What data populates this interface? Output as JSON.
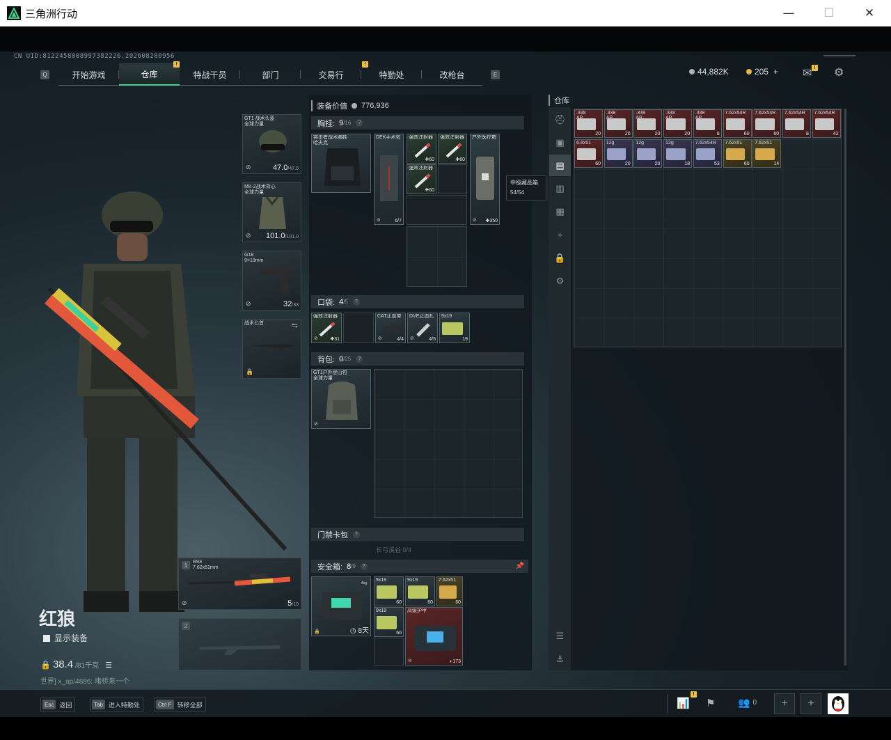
{
  "window": {
    "title": "三角洲行动",
    "minimize": "—",
    "maximize": "☐",
    "close": "✕"
  },
  "uid": "CN UID:8122458008997382226.202608280956",
  "nav": {
    "left_key": "Q",
    "right_key": "E",
    "tabs": [
      {
        "label": "开始游戏",
        "active": false,
        "badge": false
      },
      {
        "label": "仓库",
        "active": true,
        "badge": false
      },
      {
        "label": "特战干员",
        "active": false,
        "badge": true
      },
      {
        "label": "部门",
        "active": false,
        "badge": false
      },
      {
        "label": "交易行",
        "active": false,
        "badge": false
      },
      {
        "label": "特勤处",
        "active": false,
        "badge": true
      },
      {
        "label": "改枪台",
        "active": false,
        "badge": false
      }
    ]
  },
  "currency": {
    "silver": "44,882K",
    "gold": "205",
    "gold_add": "+",
    "silver_color": "#a9b4b8",
    "gold_color": "#e0b64a"
  },
  "mail_badge": "!",
  "character": {
    "name": "红狼",
    "show_gear_label": "显示装备",
    "weight": "38.4",
    "weight_max": "/81千克",
    "chat": "世界] x_ap/4886: 堵桥来一个"
  },
  "gear_slots": [
    {
      "label": "GT1 战术头盔",
      "sub": "全球力量",
      "value": "47.0",
      "max": "/47.0"
    },
    {
      "label": "MK-2战术背心",
      "sub": "全球力量",
      "value": "101.0",
      "max": "/101.0"
    },
    {
      "label": "G18",
      "sub": "9×19mm",
      "value": "32",
      "max": "/33"
    },
    {
      "label": "战术匕首",
      "sub": "",
      "value": "",
      "max": ""
    }
  ],
  "weapons": [
    {
      "slot": "1",
      "name": "R93",
      "caliber": "7.62x51mm",
      "value": "5",
      "max": "/10"
    },
    {
      "slot": "2",
      "name": "",
      "caliber": "",
      "value": "",
      "max": ""
    }
  ],
  "loadout": {
    "value_label": "装备价值",
    "value": "776,936",
    "chest": {
      "label": "胸挂:",
      "count": "9",
      "max": "/16"
    },
    "pocket": {
      "label": "口袋:",
      "count": "4",
      "max": "/5"
    },
    "backpack": {
      "label": "背包:",
      "count": "0",
      "max": "/25"
    },
    "keycard": {
      "label": "门禁卡包"
    },
    "keycard_sub": "长弓溪谷 0/4",
    "safebox": {
      "label": "安全箱:",
      "count": "8",
      "max": "/9",
      "timer": "8天"
    }
  },
  "chest_items": [
    {
      "name": "突击者战术胸挂",
      "sub": "哈夫克",
      "count": ""
    },
    {
      "name": "DEK手术包",
      "count": "6/7"
    },
    {
      "name": "强效注射器",
      "count": "60"
    },
    {
      "name": "强效注射器",
      "count": "60"
    },
    {
      "name": "强效注射器",
      "count": "60"
    },
    {
      "name": "户外医疗箱",
      "count": "350"
    }
  ],
  "tooltip": {
    "title": "中级藏品箱",
    "value": "54/54"
  },
  "pocket_items": [
    {
      "name": "强效注射器",
      "count": "31"
    },
    {
      "name": "",
      "count": ""
    },
    {
      "name": "CAT止血带",
      "count": "4/4"
    },
    {
      "name": "DVE止血扎",
      "count": "4/5"
    },
    {
      "name": "9x19",
      "count": "19"
    }
  ],
  "backpack_item": {
    "name": "GT1户外登山包",
    "sub": "全球力量"
  },
  "safebox_items": [
    {
      "name": "9x19",
      "count": "60"
    },
    {
      "name": "9x19",
      "count": "60"
    },
    {
      "name": "7.62x51",
      "count": "60"
    },
    {
      "name": "9x19",
      "count": "60"
    },
    {
      "name": "高级护甲",
      "count": "173"
    }
  ],
  "warehouse": {
    "title": "仓库",
    "row1": [
      {
        "name": ".338",
        "sub": "AP",
        "count": "20",
        "kind": "red"
      },
      {
        "name": ".338",
        "sub": "AP",
        "count": "20",
        "kind": "red"
      },
      {
        "name": ".338",
        "sub": "AP",
        "count": "20",
        "kind": "red"
      },
      {
        "name": ".338",
        "sub": "AP",
        "count": "20",
        "kind": "red"
      },
      {
        "name": ".338",
        "sub": "AP",
        "count": "8",
        "kind": "red"
      },
      {
        "name": "7.62x54R",
        "sub": "",
        "count": "60",
        "kind": "red"
      },
      {
        "name": "7.62x54R",
        "sub": "",
        "count": "60",
        "kind": "red"
      },
      {
        "name": "7.62x54R",
        "sub": "",
        "count": "8",
        "kind": "red"
      },
      {
        "name": "7.62x54R",
        "sub": "",
        "count": "42",
        "kind": "red"
      }
    ],
    "row2": [
      {
        "name": "6.8x51",
        "sub": "",
        "count": "60",
        "kind": "red"
      },
      {
        "name": "12g",
        "sub": "",
        "count": "20",
        "kind": "purple"
      },
      {
        "name": "12g",
        "sub": "",
        "count": "20",
        "kind": "purple"
      },
      {
        "name": "12g",
        "sub": "",
        "count": "18",
        "kind": "purple"
      },
      {
        "name": "7.62x54R",
        "sub": "",
        "count": "53",
        "kind": "purple"
      },
      {
        "name": "7.62x51",
        "sub": "",
        "count": "60",
        "kind": "gold"
      },
      {
        "name": "7.62x51",
        "sub": "",
        "count": "14",
        "kind": "gold"
      }
    ]
  },
  "bottom": {
    "hints": [
      {
        "key": "Esc",
        "label": "返回"
      },
      {
        "key": "Tab",
        "label": "进入特勤处"
      },
      {
        "key": "Ctrl F",
        "label": "转移全部"
      }
    ],
    "friends_count": "0"
  }
}
